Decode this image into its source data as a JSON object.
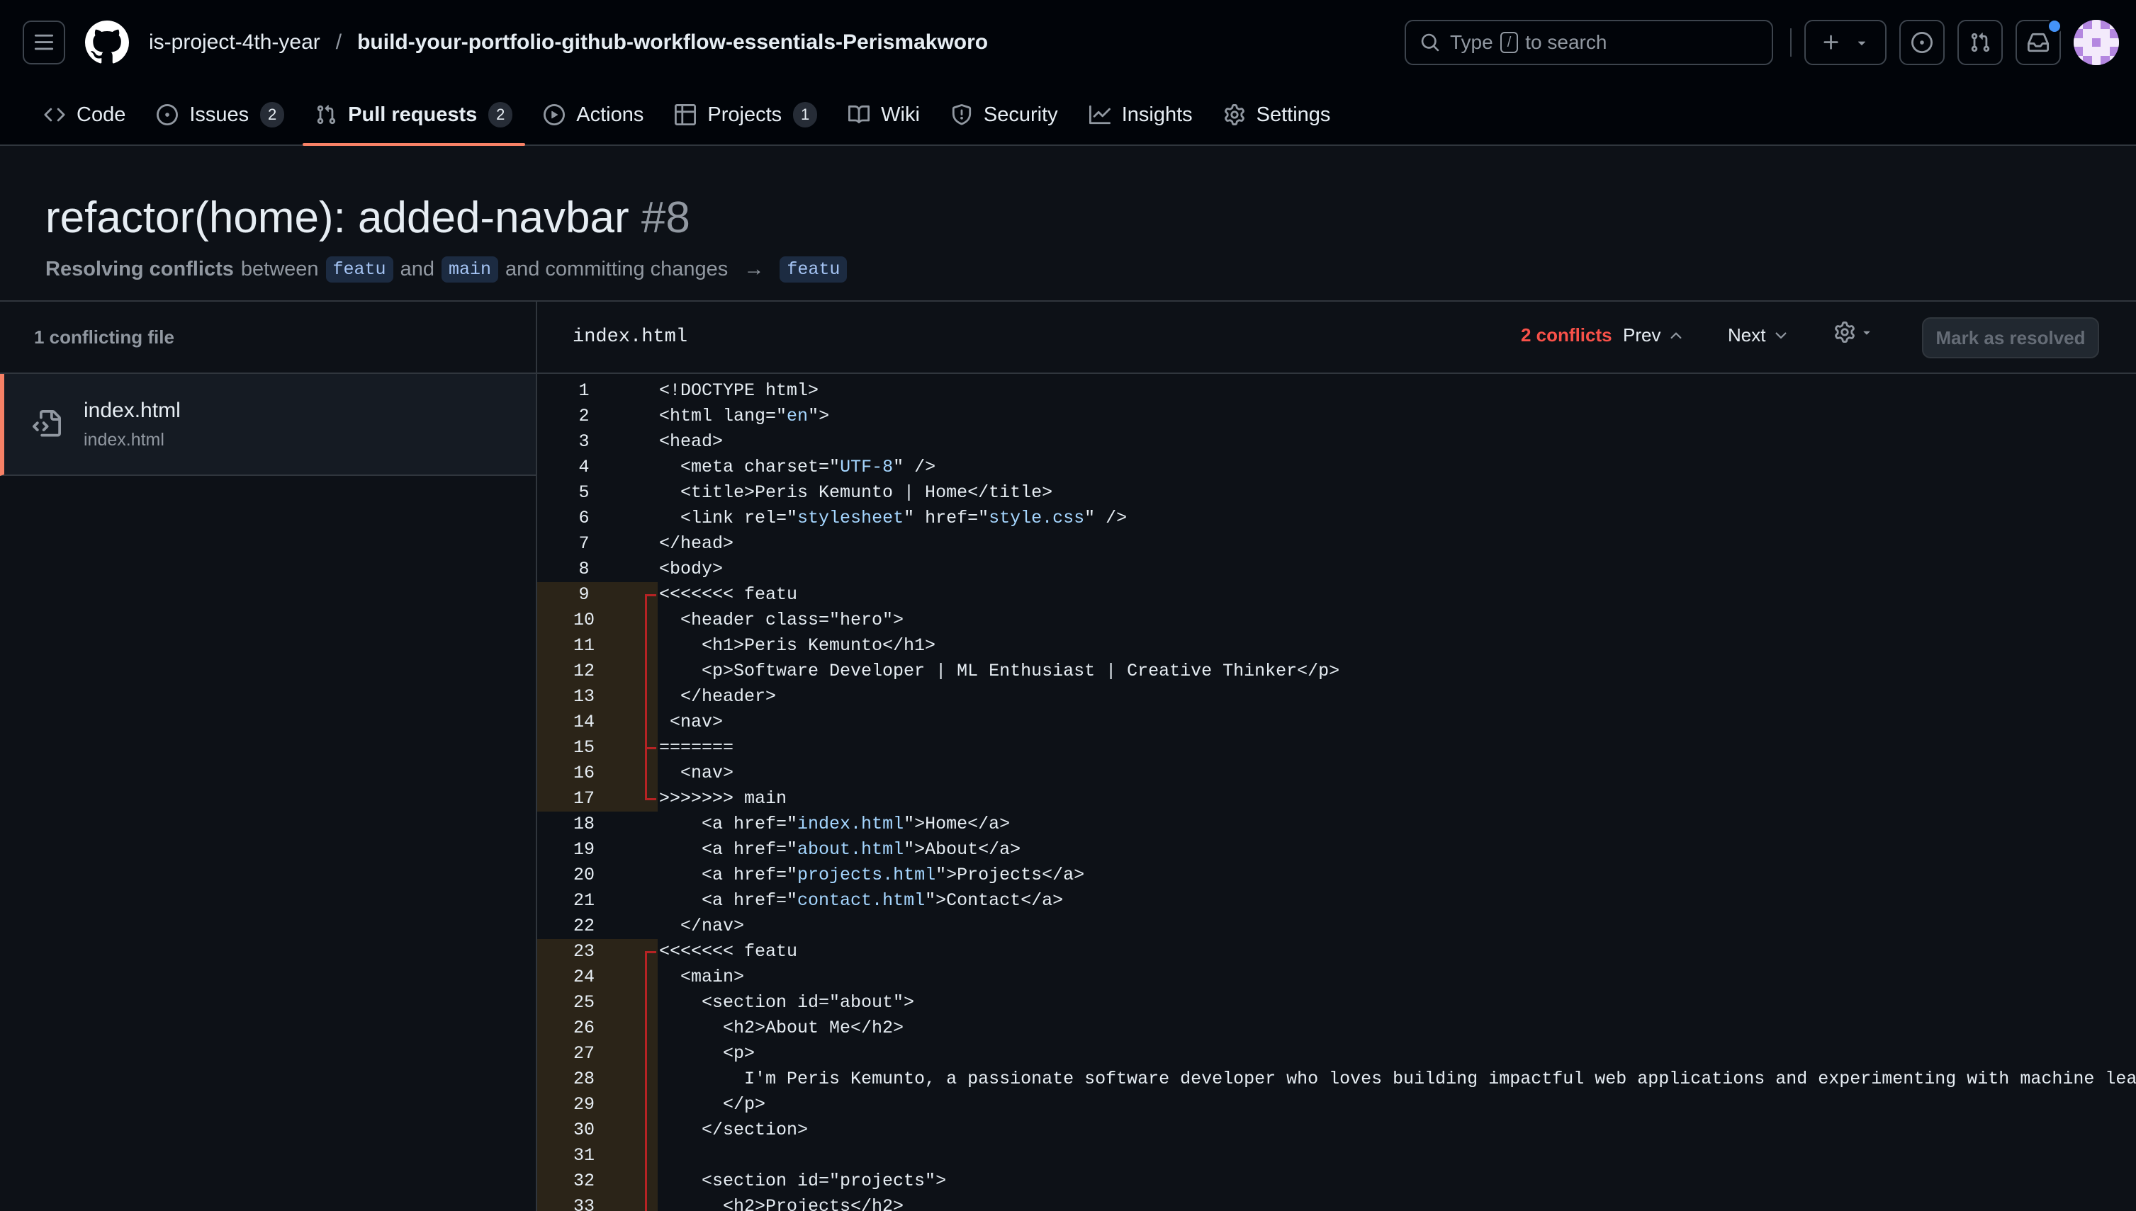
{
  "header": {
    "owner": "is-project-4th-year",
    "separator": "/",
    "repo": "build-your-portfolio-github-workflow-essentials-Perismakworo",
    "search": {
      "prefix": "Type",
      "key": "/",
      "suffix": "to search"
    }
  },
  "tabs": [
    {
      "label": "Code",
      "icon": "code-icon"
    },
    {
      "label": "Issues",
      "icon": "issue-opened-icon",
      "count": "2"
    },
    {
      "label": "Pull requests",
      "icon": "git-pull-request-icon",
      "count": "2",
      "active": true
    },
    {
      "label": "Actions",
      "icon": "play-icon"
    },
    {
      "label": "Projects",
      "icon": "table-icon",
      "count": "1"
    },
    {
      "label": "Wiki",
      "icon": "book-icon"
    },
    {
      "label": "Security",
      "icon": "shield-icon"
    },
    {
      "label": "Insights",
      "icon": "graph-icon"
    },
    {
      "label": "Settings",
      "icon": "gear-icon"
    }
  ],
  "pr": {
    "title": "refactor(home): added-navbar",
    "number": "#8",
    "resolving": "Resolving conflicts",
    "between": "between",
    "head_branch": "featu",
    "and": "and",
    "base_branch": "main",
    "committing": "and committing changes",
    "arrow": "→",
    "target_branch": "featu"
  },
  "sidebar": {
    "heading": "1 conflicting file",
    "file_name": "index.html",
    "file_path": "index.html"
  },
  "editor": {
    "file_name": "index.html",
    "conflicts": "2 conflicts",
    "prev": "Prev",
    "next": "Next",
    "mark_resolved": "Mark as resolved",
    "lines": [
      {
        "n": "1",
        "text": "<!DOCTYPE html>"
      },
      {
        "n": "2",
        "text": "<html lang=\"en\">"
      },
      {
        "n": "3",
        "text": "<head>"
      },
      {
        "n": "4",
        "text": "  <meta charset=\"UTF-8\" />"
      },
      {
        "n": "5",
        "text": "  <title>Peris Kemunto | Home</title>"
      },
      {
        "n": "6",
        "text": "  <link rel=\"stylesheet\" href=\"style.css\" />"
      },
      {
        "n": "7",
        "text": "</head>"
      },
      {
        "n": "8",
        "text": "<body>"
      },
      {
        "n": "9",
        "text": "<<<<<<< featu",
        "c": "start"
      },
      {
        "n": "10",
        "text": "  <header class=\"hero\">",
        "c": "mid"
      },
      {
        "n": "11",
        "text": "    <h1>Peris Kemunto</h1>",
        "c": "mid"
      },
      {
        "n": "12",
        "text": "    <p>Software Developer | ML Enthusiast | Creative Thinker</p>",
        "c": "mid"
      },
      {
        "n": "13",
        "text": "  </header>",
        "c": "mid"
      },
      {
        "n": "14",
        "text": " <nav>",
        "c": "mid"
      },
      {
        "n": "15",
        "text": "=======",
        "c": "sep"
      },
      {
        "n": "16",
        "text": "  <nav>",
        "c": "mid"
      },
      {
        "n": "17",
        "text": ">>>>>>> main",
        "c": "end"
      },
      {
        "n": "18",
        "text": "    <a href=\"index.html\">Home</a>"
      },
      {
        "n": "19",
        "text": "    <a href=\"about.html\">About</a>"
      },
      {
        "n": "20",
        "text": "    <a href=\"projects.html\">Projects</a>"
      },
      {
        "n": "21",
        "text": "    <a href=\"contact.html\">Contact</a>"
      },
      {
        "n": "22",
        "text": "  </nav>"
      },
      {
        "n": "23",
        "text": "<<<<<<< featu",
        "c": "start"
      },
      {
        "n": "24",
        "text": "  <main>",
        "c": "mid"
      },
      {
        "n": "25",
        "text": "    <section id=\"about\">",
        "c": "mid"
      },
      {
        "n": "26",
        "text": "      <h2>About Me</h2>",
        "c": "mid"
      },
      {
        "n": "27",
        "text": "      <p>",
        "c": "mid"
      },
      {
        "n": "28",
        "text": "        I'm Peris Kemunto, a passionate software developer who loves building impactful web applications and experimenting with machine learning. I",
        "c": "mid"
      },
      {
        "n": "29",
        "text": "      </p>",
        "c": "mid"
      },
      {
        "n": "30",
        "text": "    </section>",
        "c": "mid"
      },
      {
        "n": "31",
        "text": "",
        "c": "mid"
      },
      {
        "n": "32",
        "text": "    <section id=\"projects\">",
        "c": "mid"
      },
      {
        "n": "33",
        "text": "      <h2>Projects</h2>",
        "c": "mid"
      }
    ]
  },
  "colors": {
    "accent": "#f78166",
    "conflict_red": "#f85149",
    "string_blue": "#a5d6ff"
  }
}
